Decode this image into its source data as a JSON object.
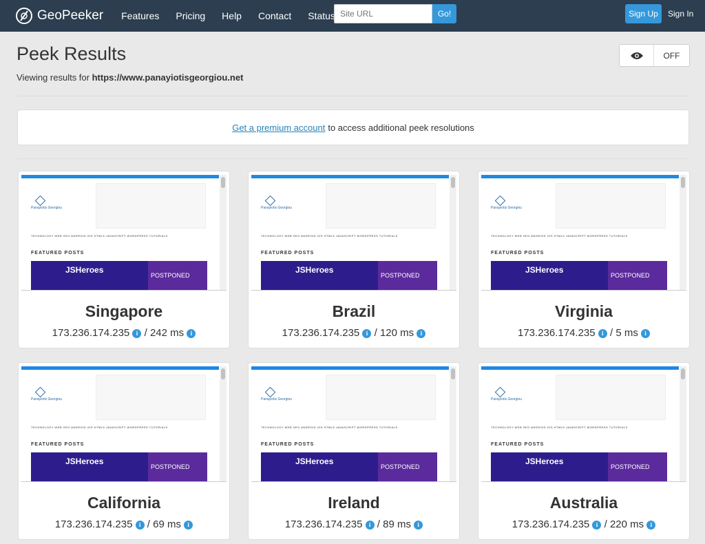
{
  "brand": {
    "name": "GeoPeeker"
  },
  "nav": {
    "links": [
      "Features",
      "Pricing",
      "Help",
      "Contact",
      "Status"
    ]
  },
  "search": {
    "placeholder": "Site URL",
    "button": "Go!"
  },
  "auth": {
    "signup": "Sign Up",
    "signin": "Sign In"
  },
  "page": {
    "title": "Peek Results",
    "viewing_label": "Viewing results for",
    "url": "https://www.panayiotisgeorgiou.net"
  },
  "toggle": {
    "icon": "eye-icon",
    "state": "OFF"
  },
  "premium": {
    "link": "Get a premium account",
    "text": "to access additional peek resolutions"
  },
  "screenshot": {
    "site": "Panayiotis Georgiou",
    "menu": "TECHNOLOGY   WEB SEO   ANDROID   IOS   HTML5   JAVASCRIPT   WORDPRESS   TUTORIALS",
    "featured": "FEATURED POSTS",
    "hero": "JSHeroes",
    "postponed": "POSTPONED"
  },
  "results": [
    {
      "city": "Singapore",
      "ip": "173.236.174.235",
      "ms": "242 ms"
    },
    {
      "city": "Brazil",
      "ip": "173.236.174.235",
      "ms": "120 ms"
    },
    {
      "city": "Virginia",
      "ip": "173.236.174.235",
      "ms": "5 ms"
    },
    {
      "city": "California",
      "ip": "173.236.174.235",
      "ms": "69 ms"
    },
    {
      "city": "Ireland",
      "ip": "173.236.174.235",
      "ms": "89 ms"
    },
    {
      "city": "Australia",
      "ip": "173.236.174.235",
      "ms": "220 ms"
    }
  ]
}
